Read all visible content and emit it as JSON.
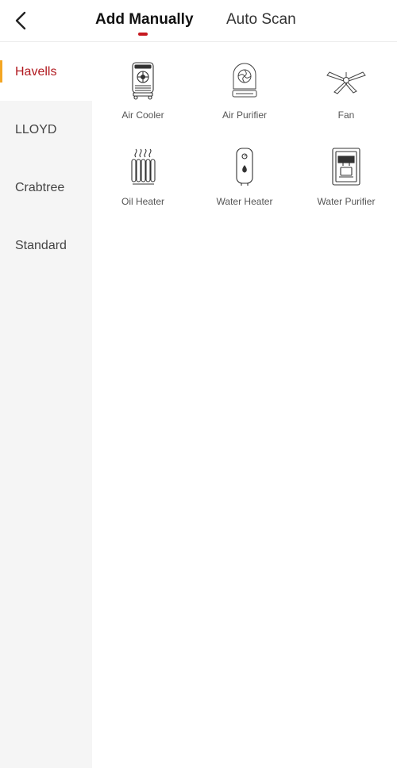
{
  "header": {
    "back_icon": "chevron-left-icon",
    "tabs": [
      {
        "label": "Add Manually",
        "active": true
      },
      {
        "label": "Auto Scan",
        "active": false
      }
    ],
    "accent_color": "#c6181f"
  },
  "sidebar": {
    "items": [
      {
        "label": "Havells",
        "active": true
      },
      {
        "label": "LLOYD",
        "active": false
      },
      {
        "label": "Crabtree",
        "active": false
      },
      {
        "label": "Standard",
        "active": false
      }
    ],
    "active_color": "#b1191f",
    "indicator_color": "#f4a623"
  },
  "devices": [
    {
      "label": "Air Cooler",
      "icon": "air-cooler-icon"
    },
    {
      "label": "Air Purifier",
      "icon": "air-purifier-icon"
    },
    {
      "label": "Fan",
      "icon": "ceiling-fan-icon"
    },
    {
      "label": "Oil Heater",
      "icon": "oil-heater-icon"
    },
    {
      "label": "Water Heater",
      "icon": "water-heater-icon"
    },
    {
      "label": "Water Purifier",
      "icon": "water-purifier-icon"
    }
  ]
}
